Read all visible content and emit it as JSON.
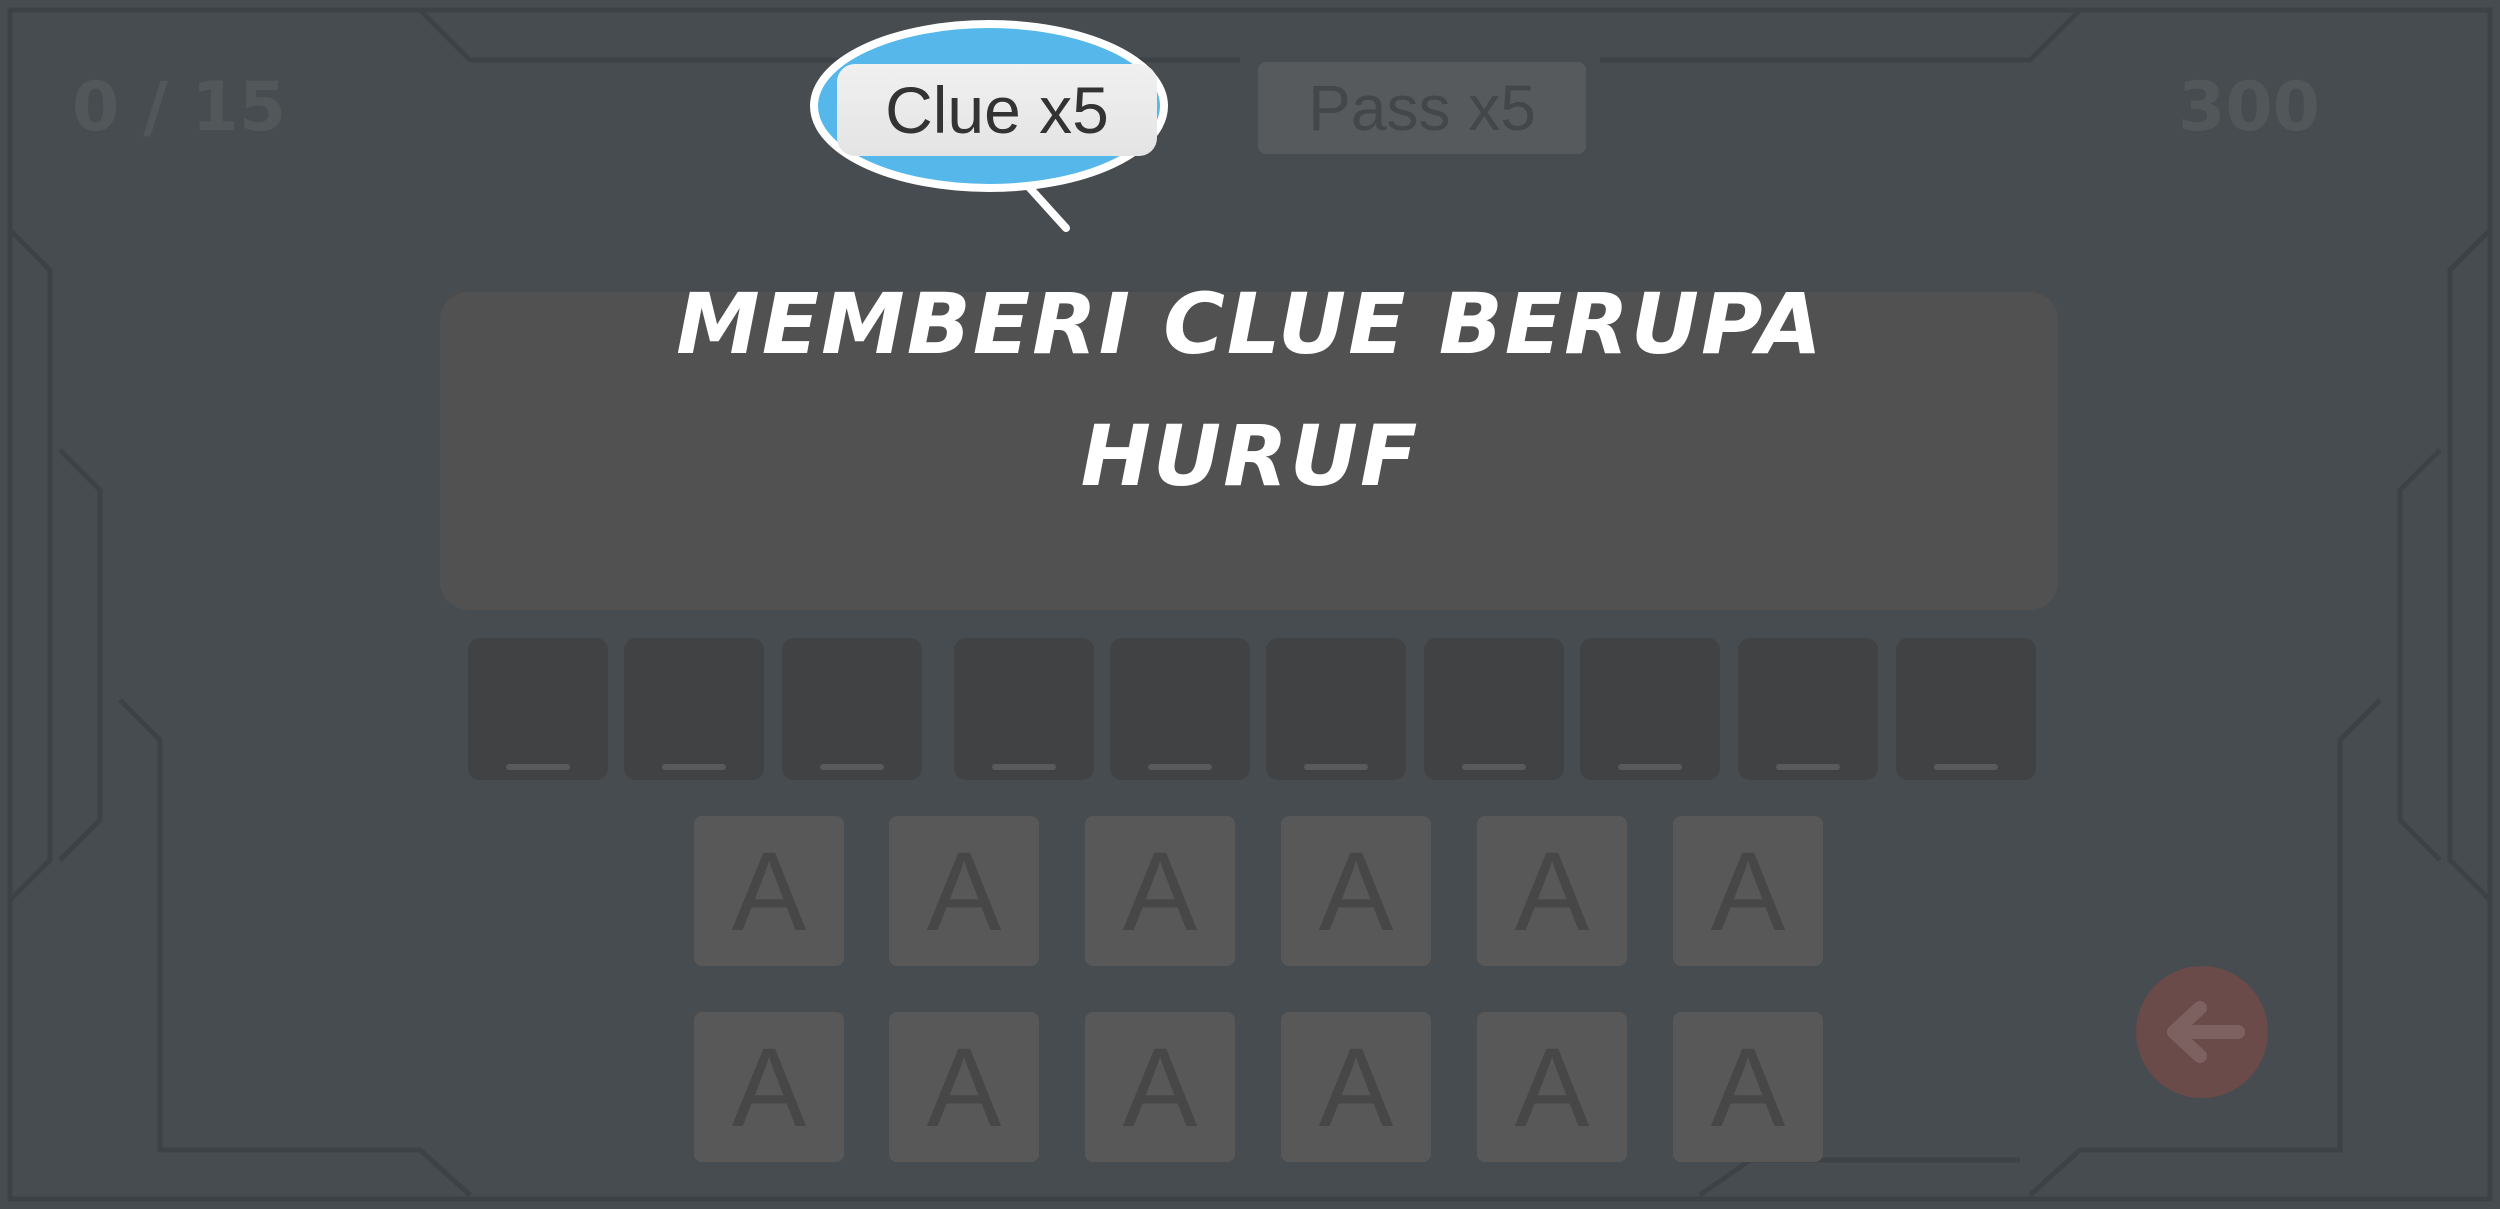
{
  "hud": {
    "progress": "0 / 15",
    "score": "300"
  },
  "buttons": {
    "clue_label": "Clue x5",
    "pass_label": "Pass x5"
  },
  "tutorial": {
    "line1": "Memberi clue berupa",
    "line2": "huruf"
  },
  "answer_slots": [
    "",
    "",
    "",
    "",
    "",
    "",
    "",
    "",
    "",
    ""
  ],
  "keyboard": {
    "row1": [
      "A",
      "A",
      "A",
      "A",
      "A",
      "A"
    ],
    "row2": [
      "A",
      "A",
      "A",
      "A",
      "A",
      "A"
    ]
  },
  "icons": {
    "back": "back-arrow-icon"
  },
  "colors": {
    "highlight": "#55b7ea",
    "overlay_bg": "#474c50",
    "back_button": "#6b4a4a"
  }
}
